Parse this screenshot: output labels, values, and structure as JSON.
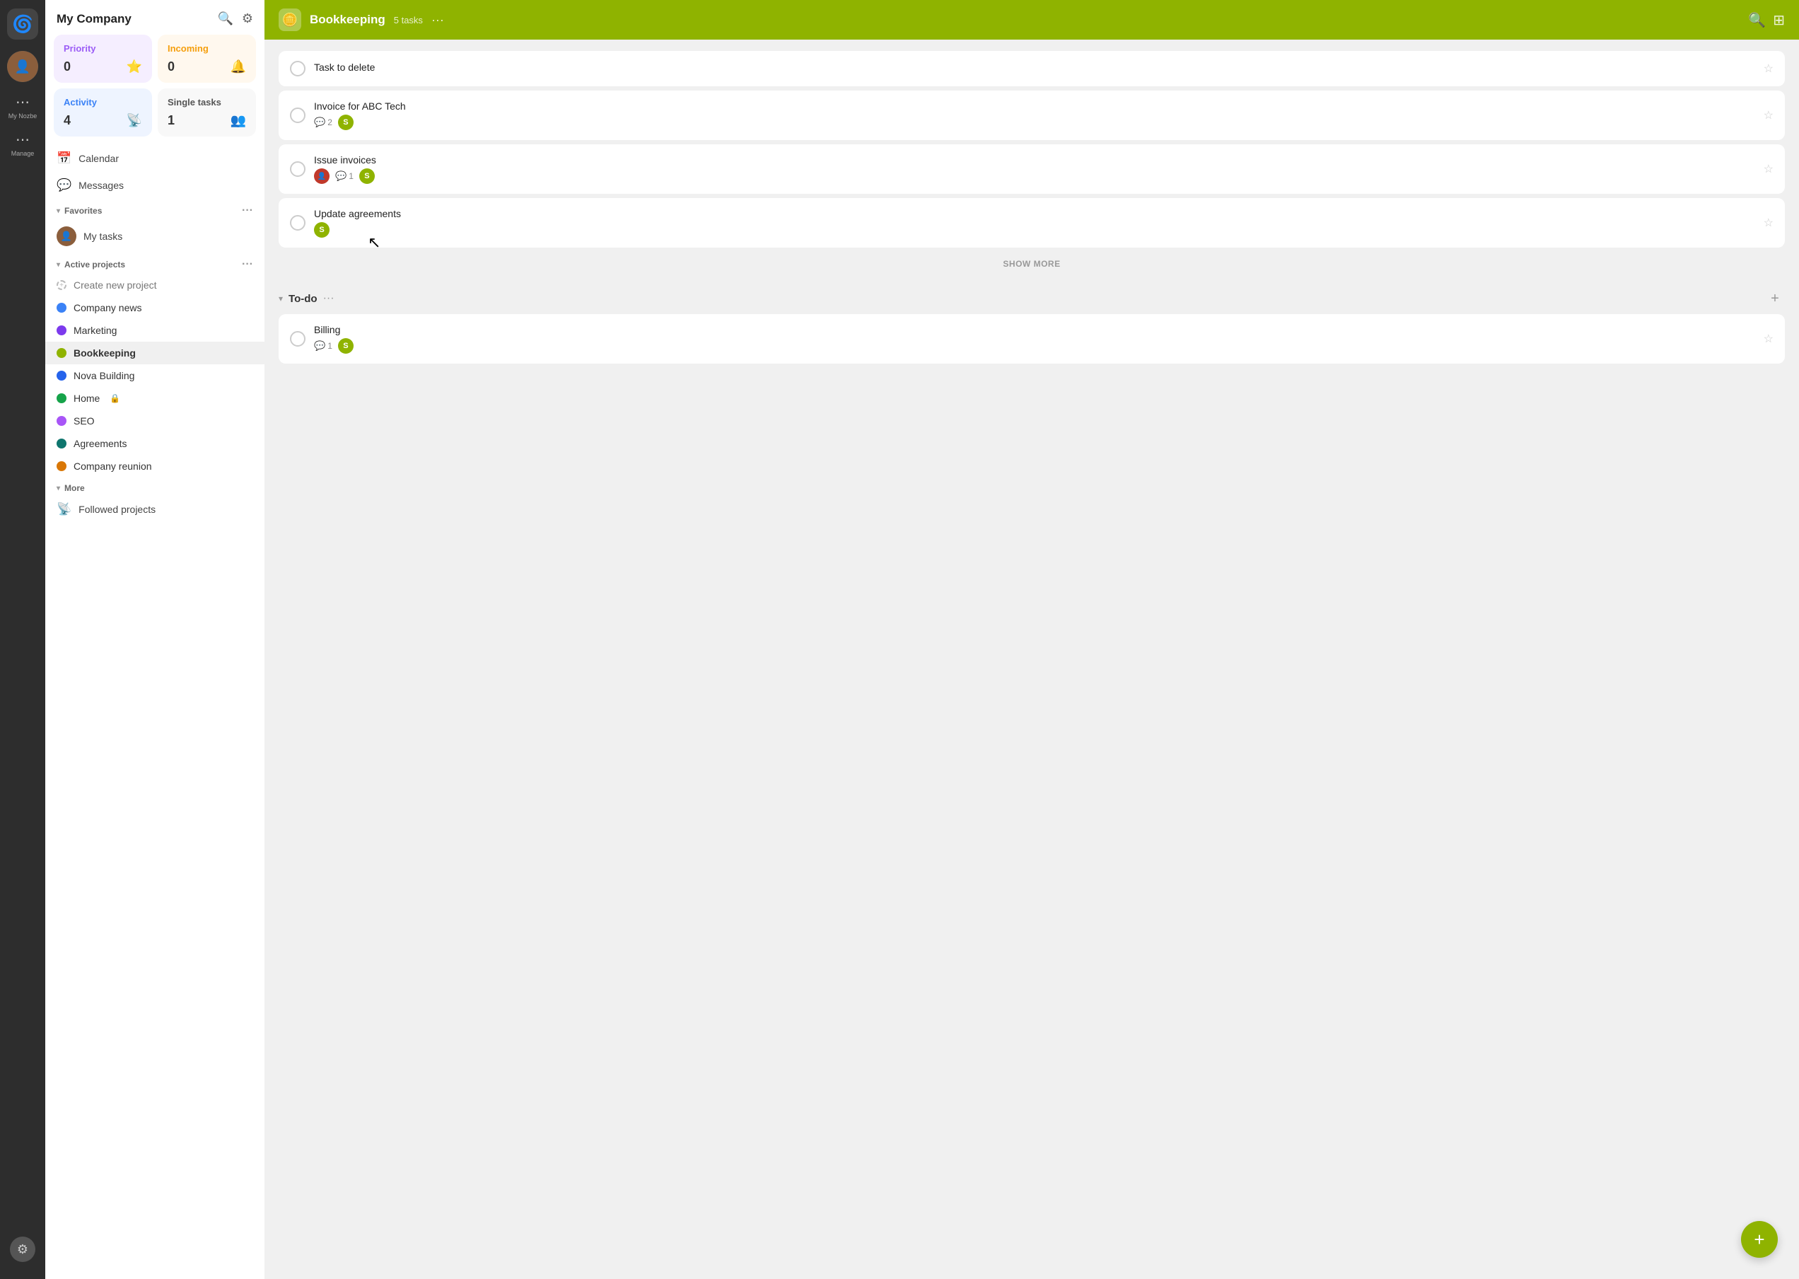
{
  "app": {
    "name": "My Company",
    "logo_emoji": "🌀"
  },
  "rail": {
    "company_label": "My Company",
    "my_nozbe_label": "My Nozbe",
    "manage_label": "Manage"
  },
  "stats": {
    "priority": {
      "label": "Priority",
      "count": "0",
      "icon": "⭐"
    },
    "incoming": {
      "label": "Incoming",
      "count": "0",
      "icon": "🔔"
    },
    "activity": {
      "label": "Activity",
      "count": "4",
      "icon": "📡"
    },
    "single": {
      "label": "Single tasks",
      "count": "1",
      "icon": "👥"
    }
  },
  "nav": {
    "calendar_label": "Calendar",
    "messages_label": "Messages",
    "calendar_icon": "📅",
    "messages_icon": "💬"
  },
  "favorites": {
    "section_label": "Favorites",
    "my_tasks_label": "My tasks"
  },
  "active_projects": {
    "section_label": "Active projects",
    "create_new_label": "Create new project",
    "items": [
      {
        "name": "Company news",
        "color": "#3b82f6"
      },
      {
        "name": "Marketing",
        "color": "#7c3aed"
      },
      {
        "name": "Bookkeeping",
        "color": "#8fb300",
        "active": true
      },
      {
        "name": "Nova Building",
        "color": "#2563eb"
      },
      {
        "name": "Home",
        "color": "#16a34a",
        "locked": true
      },
      {
        "name": "SEO",
        "color": "#a855f7"
      },
      {
        "name": "Agreements",
        "color": "#0f766e"
      },
      {
        "name": "Company reunion",
        "color": "#d97706"
      }
    ]
  },
  "more": {
    "section_label": "More",
    "followed_projects_label": "Followed projects"
  },
  "topbar": {
    "project_title": "Bookkeeping",
    "task_count": "5 tasks",
    "more_icon": "···"
  },
  "sections": [
    {
      "title": "",
      "tasks": [
        {
          "id": "t1",
          "title": "Task to delete",
          "comments": null,
          "assignee_initial": null,
          "assignee_color": null,
          "has_avatar": false,
          "starred": false
        },
        {
          "id": "t2",
          "title": "Invoice for ABC Tech",
          "comments": "2",
          "assignee_initial": "S",
          "assignee_color": "#8fb300",
          "has_avatar": false,
          "starred": false
        },
        {
          "id": "t3",
          "title": "Issue invoices",
          "comments": "1",
          "assignee_initial": "S",
          "assignee_color": "#8fb300",
          "has_avatar": true,
          "starred": false
        },
        {
          "id": "t4",
          "title": "Update agreements",
          "comments": null,
          "assignee_initial": "S",
          "assignee_color": "#8fb300",
          "has_avatar": false,
          "starred": false
        }
      ],
      "show_more": true
    },
    {
      "title": "To-do",
      "tasks": [
        {
          "id": "t5",
          "title": "Billing",
          "comments": "1",
          "assignee_initial": "S",
          "assignee_color": "#8fb300",
          "has_avatar": false,
          "starred": false
        }
      ],
      "show_more": false
    }
  ],
  "show_more_label": "SHOW MORE",
  "fab_icon": "+"
}
